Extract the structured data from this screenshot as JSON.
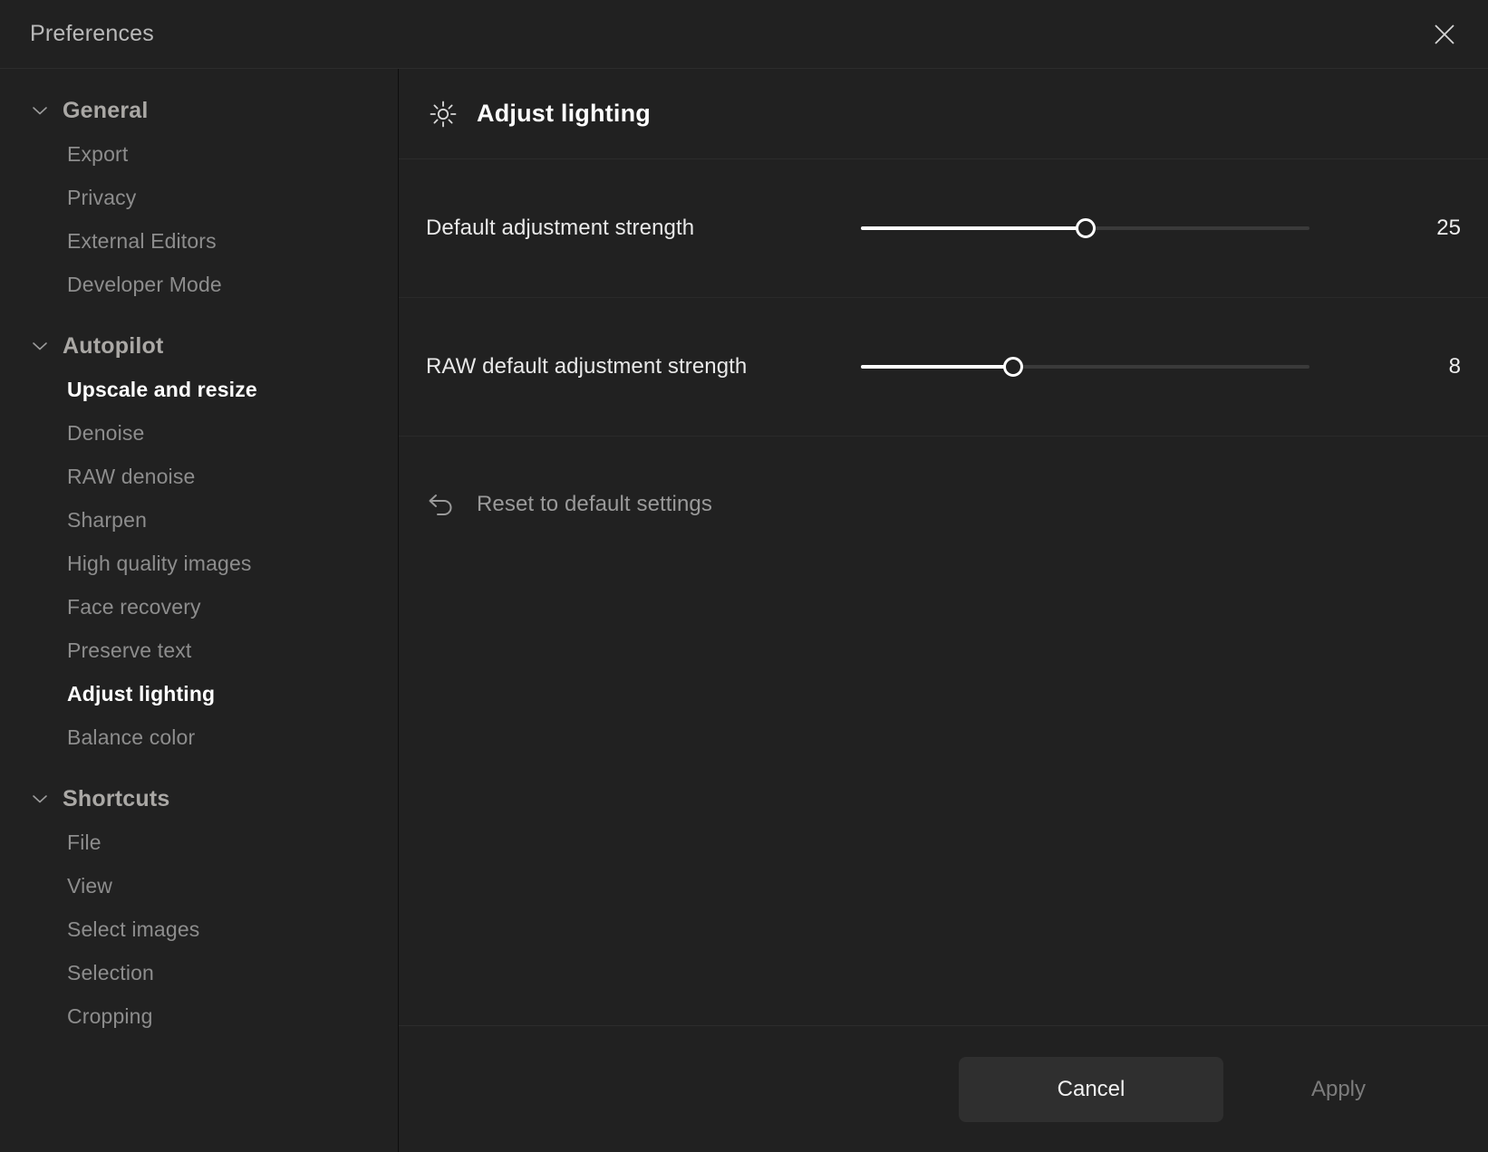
{
  "window": {
    "title": "Preferences",
    "close_icon": "close-icon"
  },
  "sidebar": {
    "groups": [
      {
        "title": "General",
        "chevron_icon": "chevron-down-icon",
        "items": [
          {
            "label": "Export",
            "selected": false
          },
          {
            "label": "Privacy",
            "selected": false
          },
          {
            "label": "External Editors",
            "selected": false
          },
          {
            "label": "Developer Mode",
            "selected": false
          }
        ]
      },
      {
        "title": "Autopilot",
        "chevron_icon": "chevron-down-icon",
        "items": [
          {
            "label": "Upscale and resize",
            "selected": true
          },
          {
            "label": "Denoise",
            "selected": false
          },
          {
            "label": "RAW denoise",
            "selected": false
          },
          {
            "label": "Sharpen",
            "selected": false
          },
          {
            "label": "High quality images",
            "selected": false
          },
          {
            "label": "Face recovery",
            "selected": false
          },
          {
            "label": "Preserve text",
            "selected": false
          },
          {
            "label": "Adjust lighting",
            "selected": true
          },
          {
            "label": "Balance color",
            "selected": false
          }
        ]
      },
      {
        "title": "Shortcuts",
        "chevron_icon": "chevron-down-icon",
        "items": [
          {
            "label": "File",
            "selected": false
          },
          {
            "label": "View",
            "selected": false
          },
          {
            "label": "Select images",
            "selected": false
          },
          {
            "label": "Selection",
            "selected": false
          },
          {
            "label": "Cropping",
            "selected": false
          }
        ]
      }
    ]
  },
  "panel": {
    "icon": "sun-brightness-icon",
    "title": "Adjust lighting",
    "settings": [
      {
        "label": "Default adjustment strength",
        "value": "25",
        "value_number": 25,
        "min": 0,
        "max": 100,
        "percent": 50
      },
      {
        "label": "RAW default adjustment strength",
        "value": "8",
        "value_number": 8,
        "min": 0,
        "max": 100,
        "percent": 34
      }
    ],
    "reset": {
      "icon": "undo-arrow-icon",
      "label": "Reset to default settings"
    }
  },
  "footer": {
    "cancel_label": "Cancel",
    "apply_label": "Apply"
  },
  "colors": {
    "background": "#212121",
    "accent": "#ffffff",
    "muted_text": "#8d8d8d",
    "divider": "#2c2c2c"
  }
}
